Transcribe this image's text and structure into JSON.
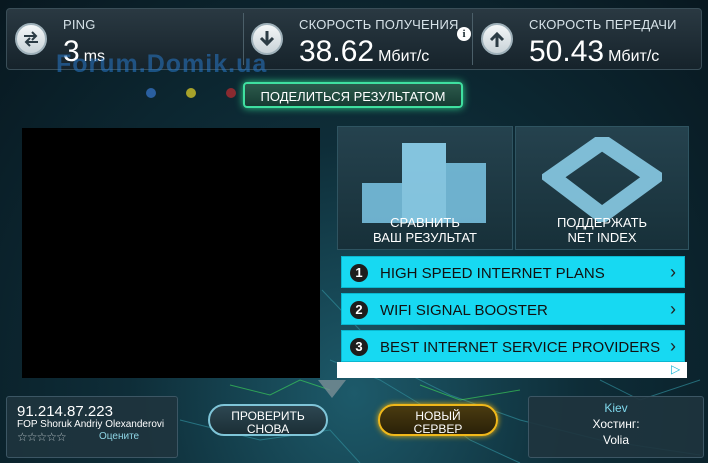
{
  "metrics": {
    "ping": {
      "label": "PING",
      "value": "3",
      "unit": "ms"
    },
    "download": {
      "label": "СКОРОСТЬ ПОЛУЧЕНИЯ",
      "value": "38.62",
      "unit": "Мбит/с"
    },
    "upload": {
      "label": "СКОРОСТЬ ПЕРЕДАЧИ",
      "value": "50.43",
      "unit": "Мбит/с"
    },
    "info_icon": "i"
  },
  "watermark": "Forum.Domik.ua",
  "share_label": "ПОДЕЛИТЬСЯ РЕЗУЛЬТАТОМ",
  "tiles": {
    "compare": {
      "line1": "СРАВНИТЬ",
      "line2": "ВАШ РЕЗУЛЬТАТ"
    },
    "support": {
      "line1": "ПОДДЕРЖАТЬ",
      "line2": "NET INDEX"
    }
  },
  "ads": [
    {
      "num": "1",
      "text": "HIGH SPEED INTERNET PLANS"
    },
    {
      "num": "2",
      "text": "WIFI SIGNAL BOOSTER"
    },
    {
      "num": "3",
      "text": "BEST INTERNET SERVICE PROVIDERS"
    }
  ],
  "ad_chevron": "›",
  "ad_choices_glyph": "▷",
  "client": {
    "ip": "91.214.87.223",
    "isp": "FOP Shoruk Andriy Olexanderovi",
    "stars": "☆☆☆☆☆",
    "rate_label": "Оцените"
  },
  "buttons": {
    "retest": {
      "line1": "ПРОВЕРИТЬ",
      "line2": "СНОВА"
    },
    "new_server": {
      "line1": "НОВЫЙ",
      "line2": "СЕРВЕР"
    }
  },
  "server": {
    "city": "Kiev",
    "host_label": "Хостинг:",
    "host": "Volia"
  },
  "colors": {
    "accent_green": "#3fe0a0",
    "accent_cyan": "#17d9f2",
    "accent_gold": "#f0b81a"
  },
  "icons": {
    "ping": "arrows-exchange-icon",
    "download": "download-arrow-icon",
    "upload": "upload-arrow-icon"
  }
}
